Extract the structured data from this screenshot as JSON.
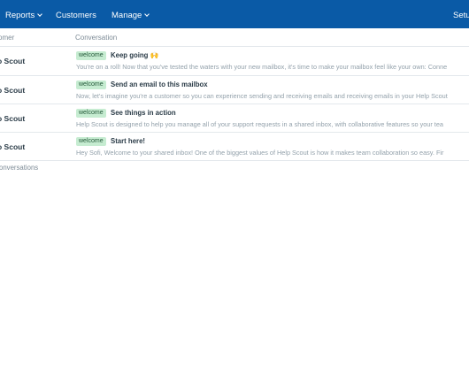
{
  "nav": {
    "reports": "Reports",
    "customers": "Customers",
    "manage": "Manage",
    "setup": "Setup"
  },
  "table": {
    "columns": {
      "customer": "omer",
      "conversation": "Conversation"
    },
    "rows": [
      {
        "customer": "o Scout",
        "tag": "welcome",
        "subject": "Keep going 🙌",
        "preview": "You're on a roll! Now that you've tested the waters with your new mailbox, it's time to make your mailbox feel like your own: Conne"
      },
      {
        "customer": "o Scout",
        "tag": "welcome",
        "subject": "Send an email to this mailbox",
        "preview": "Now, let's imagine you're a customer so you can experience sending and receiving emails and receiving emails in your Help Scout"
      },
      {
        "customer": "o Scout",
        "tag": "welcome",
        "subject": "See things in action",
        "preview": "Help Scout is designed to help you manage all of your support requests in a shared inbox, with collaborative features so your tea"
      },
      {
        "customer": "o Scout",
        "tag": "welcome",
        "subject": "Start here!",
        "preview": "Hey Sofi, Welcome to your shared inbox! One of the biggest values of Help Scout is how it makes team collaboration so easy. Fir"
      }
    ],
    "footer": "onversations"
  },
  "colors": {
    "nav_bg": "#0a5aa6",
    "badge_bg": "#c6ecd1",
    "badge_text": "#25593a"
  }
}
